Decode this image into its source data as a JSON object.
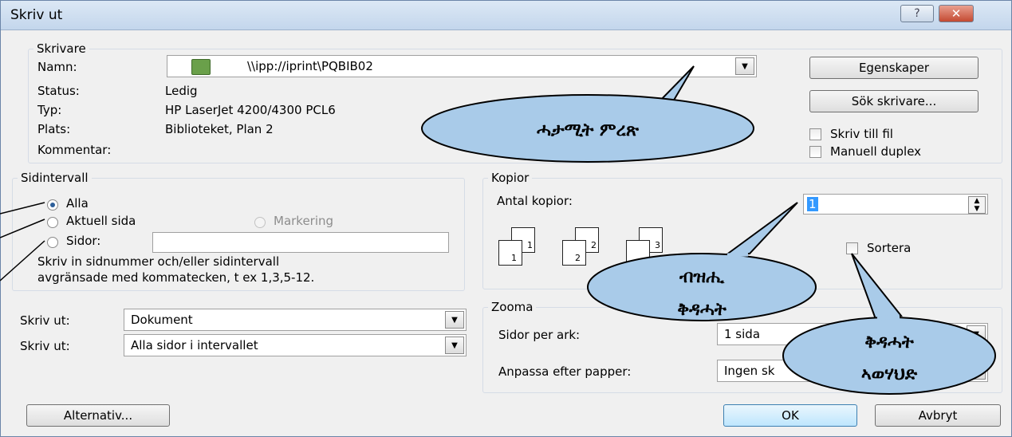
{
  "window": {
    "title": "Skriv ut",
    "help_glyph": "?",
    "close_glyph": "✕"
  },
  "printer": {
    "group": "Skrivare",
    "name_label": "Namn:",
    "name_value": "\\\\ipp://iprint\\PQBIB02",
    "status_label": "Status:",
    "status_value": "Ledig",
    "type_label": "Typ:",
    "type_value": "HP LaserJet 4200/4300 PCL6",
    "location_label": "Plats:",
    "location_value": "Biblioteket, Plan 2",
    "comment_label": "Kommentar:",
    "properties_button": "Egenskaper",
    "find_button": "Sök skrivare...",
    "print_to_file": "Skriv till fil",
    "manual_duplex": "Manuell duplex"
  },
  "range": {
    "group": "Sidintervall",
    "all": "Alla",
    "current": "Aktuell sida",
    "selection": "Markering",
    "pages": "Sidor:",
    "hint_line1": "Skriv in sidnummer och/eller sidintervall",
    "hint_line2": "avgränsade med kommatecken, t ex 1,3,5-12."
  },
  "print_what": {
    "label1": "Skriv ut:",
    "value1": "Dokument",
    "label2": "Skriv ut:",
    "value2": "Alla sidor i intervallet"
  },
  "copies": {
    "group": "Kopior",
    "count_label": "Antal kopior:",
    "count_value": "1",
    "collate": "Sortera",
    "page_numbers": [
      "1",
      "1",
      "2",
      "2",
      "3"
    ]
  },
  "zoom": {
    "group": "Zooma",
    "per_sheet_label": "Sidor per ark:",
    "per_sheet_value": "1 sida",
    "scale_label": "Anpassa efter papper:",
    "scale_value": "Ingen sk"
  },
  "footer": {
    "options_button": "Alternativ...",
    "ok_button": "OK",
    "cancel_button": "Avbryt"
  },
  "callouts": {
    "printer_name": "ሓታሚት ምረጽ",
    "copies_line1": "ብዝሒ",
    "copies_line2": "ቅዳሓት",
    "collate_line1": "ቅዳሓት",
    "collate_line2": "ኣወሃህድ"
  },
  "colors": {
    "callout_fill": "#a9cbe9",
    "accent": "#3c7fb1"
  }
}
